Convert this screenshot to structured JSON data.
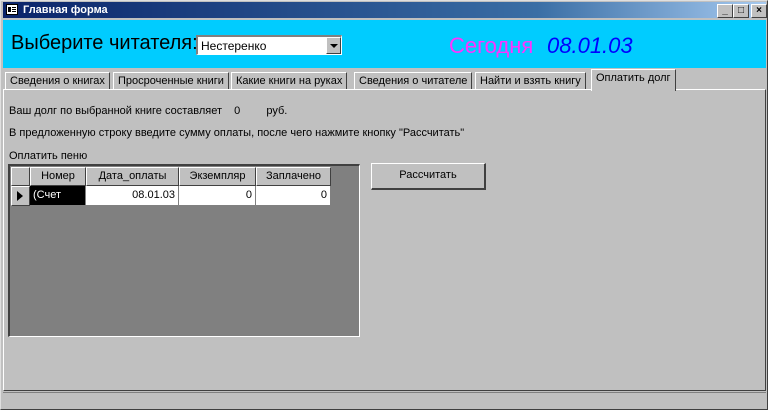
{
  "window": {
    "title": "Главная форма"
  },
  "titlebar_buttons": {
    "minimize": "_",
    "maximize": "□",
    "close": "×"
  },
  "header": {
    "prompt": "Выберите читателя:",
    "reader_combo_value": "Нестеренко",
    "today_label": "Сегодня",
    "today_date": "08.01.03"
  },
  "tabs": [
    {
      "label": "Сведения о книгах"
    },
    {
      "label": "Просроченные книги"
    },
    {
      "label": "Какие книги на руках"
    },
    {
      "label": "Сведения о читателе"
    },
    {
      "label": "Найти и взять книгу"
    },
    {
      "label": "Оплатить долг",
      "active": true
    }
  ],
  "debt": {
    "text_prefix": "Ваш долг по выбранной книге составляет",
    "amount": "0",
    "currency": "руб.",
    "instruction": "В предложенную строку введите сумму оплаты, после чего нажмите кнопку \"Рассчитать\"",
    "subform_label": "Оплатить пеню"
  },
  "grid": {
    "columns": [
      "Номер",
      "Дата_оплаты",
      "Экземпляр",
      "Заплачено"
    ],
    "rows": [
      [
        "(Счет",
        "08.01.03",
        "0",
        "0"
      ]
    ]
  },
  "calculate_button": "Рассчитать"
}
